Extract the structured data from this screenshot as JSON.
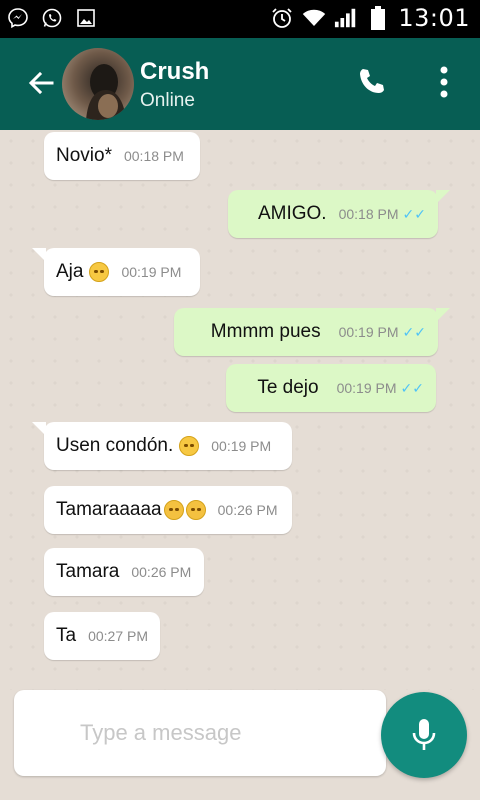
{
  "status_bar": {
    "time": "13:01",
    "left_icons": [
      "messenger-icon",
      "whatsapp-icon",
      "gallery-icon"
    ],
    "right_icons": [
      "alarm-icon",
      "wifi-icon",
      "signal-icon",
      "battery-icon"
    ]
  },
  "header": {
    "contact_name": "Crush",
    "contact_status": "Online",
    "icons": [
      "back-arrow-icon",
      "phone-icon",
      "more-vert-icon"
    ],
    "color": "#075e54"
  },
  "messages": [
    {
      "dir": "in",
      "text": "Novio*",
      "time": "00:18 PM"
    },
    {
      "dir": "out",
      "text": "AMIGO.",
      "time": "00:18 PM",
      "read": true
    },
    {
      "dir": "in",
      "text": "Aja",
      "emoji": [
        "laughing-tears"
      ],
      "time": "00:19 PM"
    },
    {
      "dir": "out",
      "text": "Mmmm pues",
      "time": "00:19 PM",
      "read": true
    },
    {
      "dir": "out",
      "text": "Te dejo",
      "time": "00:19 PM",
      "read": true
    },
    {
      "dir": "in",
      "text": "Usen condón.",
      "emoji": [
        "smiling-face"
      ],
      "time": "00:19 PM"
    },
    {
      "dir": "in",
      "text": "Tamaraaaaa",
      "emoji": [
        "disappointed-face",
        "disappointed-face"
      ],
      "time": "00:26 PM"
    },
    {
      "dir": "in",
      "text": "Tamara",
      "time": "00:26 PM"
    },
    {
      "dir": "in",
      "text": "Ta",
      "time": "00:27 PM"
    }
  ],
  "composer": {
    "placeholder": "Type a message",
    "value": "",
    "send_icon": "mic-icon"
  },
  "colors": {
    "incoming_bubble": "#ffffff",
    "outgoing_bubble": "#dcf8c6",
    "read_ticks": "#4fc3f7",
    "mic_button": "#128c7e"
  }
}
